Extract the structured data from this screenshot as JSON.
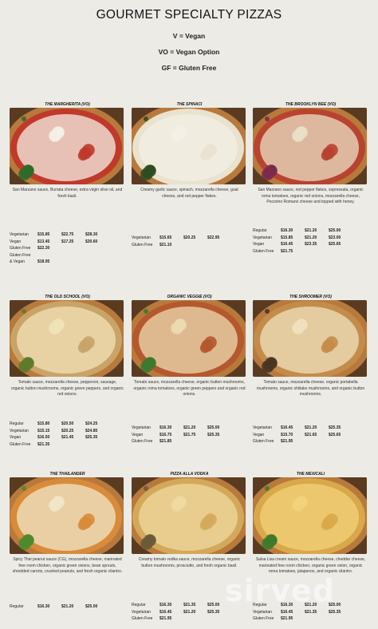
{
  "title": "GOURMET SPECIALTY PIZZAS",
  "legend": [
    "V = Vegan",
    "VO = Vegan Option",
    "GF = Gluten Free"
  ],
  "pizzas": [
    {
      "name": "THE MARGHERITA (VO)",
      "description": "San Marzano sauce, Burrata cheese, extra virgin olive oil, and fresh basil.",
      "prices": [
        {
          "label": "Vegetarian",
          "values": [
            "$15.85",
            "$22.75",
            "$28.30"
          ]
        },
        {
          "label": "Vegan",
          "values": [
            "$13.45",
            "$17.25",
            "$30.60"
          ]
        },
        {
          "label": "Gluten Free",
          "values": [
            "$22.30"
          ]
        },
        {
          "label": "Gluten Free",
          "values": []
        },
        {
          "label": "& Vegan",
          "values": [
            "$18.95"
          ]
        }
      ],
      "colors": {
        "sauce": "#c0392b",
        "cheese": "#f4efe4",
        "topping": "#2f6b2a"
      }
    },
    {
      "name": "THE SPINACI",
      "description": "Creamy garlic sauce, spinach, mozzarella cheese, goat cheese, and red pepper flakes.",
      "prices": [
        {
          "label": "Vegetarian",
          "values": [
            "$15.65",
            "$20.25",
            "$22.95"
          ]
        },
        {
          "label": "Gluten Free",
          "values": [
            "$21.10"
          ]
        }
      ],
      "colors": {
        "sauce": "#e9e2cf",
        "cheese": "#f3efe5",
        "topping": "#2e4d22"
      }
    },
    {
      "name": "THE BROOKLYN BEE (VO)",
      "description": "San Marzano sauce, red pepper flakes, sopressata, organic roma tomatoes, organic red onions, mozzarella cheese, Pecorino Romano cheese and topped with honey.",
      "prices": [
        {
          "label": "Regular",
          "values": [
            "$16.30",
            "$21.20",
            "$25.00"
          ]
        },
        {
          "label": "Vegetarian",
          "values": [
            "$15.85",
            "$21.20",
            "$23.00"
          ]
        },
        {
          "label": "Vegan",
          "values": [
            "$16.45",
            "$23.35",
            "$25.65"
          ]
        },
        {
          "label": "Gluten Free",
          "values": [
            "$21.75"
          ]
        }
      ],
      "colors": {
        "sauce": "#b8432e",
        "cheese": "#eadfc6",
        "topping": "#7a2a4a"
      }
    },
    {
      "name": "THE OLD SCHOOL (VO)",
      "description": "Tomato sauce, mozzarella cheese, pepperoni, sausage, organic button mushrooms, organic green peppers, and organic red onions.",
      "prices": [
        {
          "label": "Regular",
          "values": [
            "$15.80",
            "$20.50",
            "$24.25"
          ]
        },
        {
          "label": "Vegetarian",
          "values": [
            "$15.15",
            "$20.25",
            "$24.85"
          ]
        },
        {
          "label": "Vegan",
          "values": [
            "$16.50",
            "$21.45",
            "$25.35"
          ]
        },
        {
          "label": "Gluten Free",
          "values": [
            "$21.35"
          ]
        }
      ],
      "colors": {
        "sauce": "#c9a468",
        "cheese": "#f1e2b8",
        "topping": "#5e7a2a"
      }
    },
    {
      "name": "ORGANIC VEGGIE (VO)",
      "description": "Tomato sauce, mozzarella cheese, organic button mushrooms, organic roma tomatoes, organic green peppers and organic red onions.",
      "prices": [
        {
          "label": "Vegetarian",
          "values": [
            "$16.30",
            "$21.20",
            "$25.00"
          ]
        },
        {
          "label": "Vegan",
          "values": [
            "$16.75",
            "$21.75",
            "$25.35"
          ]
        },
        {
          "label": "Gluten Free",
          "values": [
            "$21.85"
          ]
        }
      ],
      "colors": {
        "sauce": "#b5582e",
        "cheese": "#ecd9b0",
        "topping": "#3d7a2e"
      }
    },
    {
      "name": "THE SHROOMER (VO)",
      "description": "Tomato sauce, mozzarella cheese, organic portabella mushrooms, organic shiitake mushrooms, and organic button mushrooms.",
      "prices": [
        {
          "label": "Vegetarian",
          "values": [
            "$16.45",
            "$21.20",
            "$25.35"
          ]
        },
        {
          "label": "Vegan",
          "values": [
            "$15.70",
            "$21.65",
            "$25.65"
          ]
        },
        {
          "label": "Gluten Free",
          "values": [
            "$21.95"
          ]
        }
      ],
      "colors": {
        "sauce": "#c48c4a",
        "cheese": "#efe0bd",
        "topping": "#4a3526"
      }
    },
    {
      "name": "THE THAILANDER",
      "description": "Spicy Thai peanut sauce (CG), mozzarella cheese, marinated free room chicken, organic green onions, bean sprouts, shredded carrots, crushed peanuts, and fresh organic cilantro.",
      "prices": [
        {
          "label": "Regular",
          "values": [
            "$16.30",
            "$21.20",
            "$25.00"
          ]
        }
      ],
      "colors": {
        "sauce": "#d88b3a",
        "cheese": "#f2e6c8",
        "topping": "#4c8a2e"
      }
    },
    {
      "name": "PIZZA ALLA VODKA",
      "description": "Creamy tomato vodka sauce, mozzarella cheese, organic button mushrooms, prosciutto, and fresh organic basil.",
      "prices": [
        {
          "label": "Regular",
          "values": [
            "$16.30",
            "$21.35",
            "$25.00"
          ]
        },
        {
          "label": "Vegetarian",
          "values": [
            "$16.45",
            "$21.20",
            "$25.35"
          ]
        },
        {
          "label": "Gluten Free",
          "values": [
            "$21.95"
          ]
        }
      ],
      "colors": {
        "sauce": "#d4a85a",
        "cheese": "#f0d9a0",
        "topping": "#6a5a3a"
      }
    },
    {
      "name": "THE MEXICALI",
      "description": "Salsa Lisa cream sauce, mozzarella cheese, cheddar cheese, marinated free room chicken, organic green onion, organic roma tomatoes, jalapenos, and organic cilantro.",
      "prices": [
        {
          "label": "Regular",
          "values": [
            "$16.30",
            "$21.20",
            "$25.00"
          ]
        },
        {
          "label": "Vegetarian",
          "values": [
            "$16.45",
            "$21.35",
            "$25.35"
          ]
        },
        {
          "label": "Gluten Free",
          "values": [
            "$21.95"
          ]
        }
      ],
      "colors": {
        "sauce": "#d9a84a",
        "cheese": "#f2d27a",
        "topping": "#3f7a2a"
      }
    }
  ],
  "watermark": "sirved"
}
